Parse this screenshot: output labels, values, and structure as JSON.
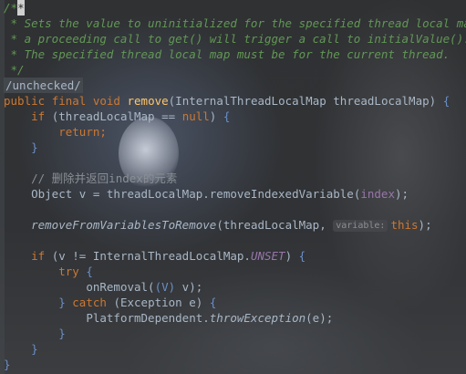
{
  "editor": {
    "doc_open": "/*",
    "doc_cursor": "*",
    "doc_line1": " * Sets the value to uninitialized for the specified thread local map;",
    "doc_line2": " * a proceeding call to get() will trigger a call to initialValue().",
    "doc_line3": " * The specified thread local map must be for the current thread.",
    "doc_close": " */",
    "annotation": "/unchecked/",
    "method_decl": {
      "public": "public",
      "final": "final",
      "void": "void",
      "name": "remove",
      "params": "(InternalThreadLocalMap threadLocalMap) ",
      "brace": "{"
    },
    "if1": {
      "kw": "if",
      "cond_a": " (threadLocalMap == ",
      "null": "null",
      "cond_b": ") ",
      "brace": "{"
    },
    "return_kw": "return",
    "return_semi": ";",
    "close1": "}",
    "cn_comment": "// 删除并返回index的元素",
    "obj_line": {
      "type": "Object v = threadLocalMap.removeIndexedVariable(",
      "field": "index",
      "end": ");"
    },
    "remove_line": {
      "fn": "removeFromVariablesToRemove",
      "args": "(threadLocalMap, ",
      "hint": "variable:",
      "this": "this",
      "end": ");"
    },
    "if2": {
      "kw": "if",
      "cond_a": " (v != InternalThreadLocalMap.",
      "unset": "UNSET",
      "cond_b": ") ",
      "brace": "{"
    },
    "try_kw": "try",
    "try_brace": "{",
    "on_removal": {
      "name": "onRemoval(",
      "cast": "(V)",
      "end": " v);"
    },
    "catch_line": {
      "close": "}",
      "kw": "catch",
      "args": " (Exception e) ",
      "brace": "{"
    },
    "throw_line": {
      "cls": "PlatformDependent.",
      "fn": "throwException",
      "end": "(e);"
    },
    "close_inner": "}",
    "close_if": "}",
    "close_method": "}"
  }
}
